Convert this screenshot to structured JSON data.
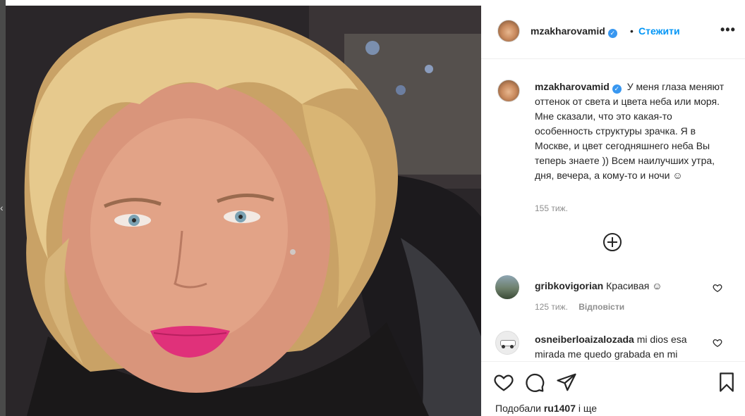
{
  "post": {
    "author": "mzakharovamid",
    "follow_label": "Стежити",
    "separator": "•",
    "more_label": "•••",
    "verified_mark": "✓"
  },
  "caption": {
    "username": "mzakharovamid",
    "text": "У меня глаза меняют оттенок от света и цвета неба или моря. Мне сказали, что это какая-то особенность структуры зрачка. Я в Москве, и цвет сегодняшнего неба Вы теперь знаете )) Всем наилучших утра, дня, вечера, а кому-то и ночи ☺",
    "time": "155 тиж."
  },
  "comments": [
    {
      "username": "gribkovigorian",
      "text": "Красивая ☺",
      "time": "125 тиж.",
      "reply_label": "Відповісти"
    },
    {
      "username": "osneiberloaizalozada",
      "text": "mi dios esa mirada me quedo grabada en mi"
    }
  ],
  "likes": {
    "prefix": "Подобали",
    "user": "ru1407",
    "suffix": "і ще"
  },
  "icons": {
    "like": "heart-icon",
    "comment": "comment-icon",
    "share": "share-icon",
    "save": "bookmark-icon",
    "load_more": "plus-circle-icon",
    "verified": "verified-badge-icon"
  },
  "colors": {
    "follow": "#0095f6",
    "verified": "#3897f0",
    "lips": "#e0317a"
  }
}
